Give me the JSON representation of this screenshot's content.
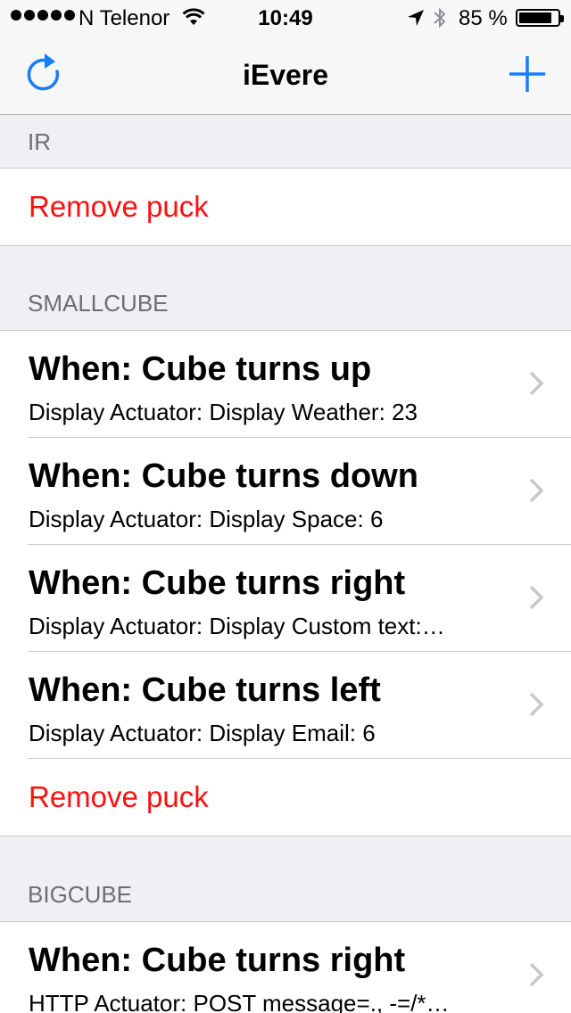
{
  "status_bar": {
    "carrier": "N Telenor",
    "time": "10:49",
    "battery_percent_label": "85 %",
    "battery_level": 0.85
  },
  "nav": {
    "title": "iEvere",
    "left_icon": "refresh-icon",
    "right_icon": "plus-icon"
  },
  "colors": {
    "accent": "#157efb",
    "destructive": "#ff0f0f"
  },
  "sections": [
    {
      "header": "IR",
      "rows": [],
      "remove_label": "Remove puck"
    },
    {
      "header": "SMALLCUBE",
      "rows": [
        {
          "title": "When: Cube turns up",
          "subtitle": "Display Actuator: Display Weather: 23"
        },
        {
          "title": "When: Cube turns down",
          "subtitle": "Display Actuator: Display Space: 6"
        },
        {
          "title": "When: Cube turns right",
          "subtitle": "Display Actuator: Display Custom text:…"
        },
        {
          "title": "When: Cube turns left",
          "subtitle": "Display Actuator: Display Email: 6"
        }
      ],
      "remove_label": "Remove puck"
    },
    {
      "header": "BIGCUBE",
      "rows": [
        {
          "title": "When: Cube turns right",
          "subtitle": "HTTP Actuator: POST message=., -=/*…"
        }
      ]
    }
  ]
}
